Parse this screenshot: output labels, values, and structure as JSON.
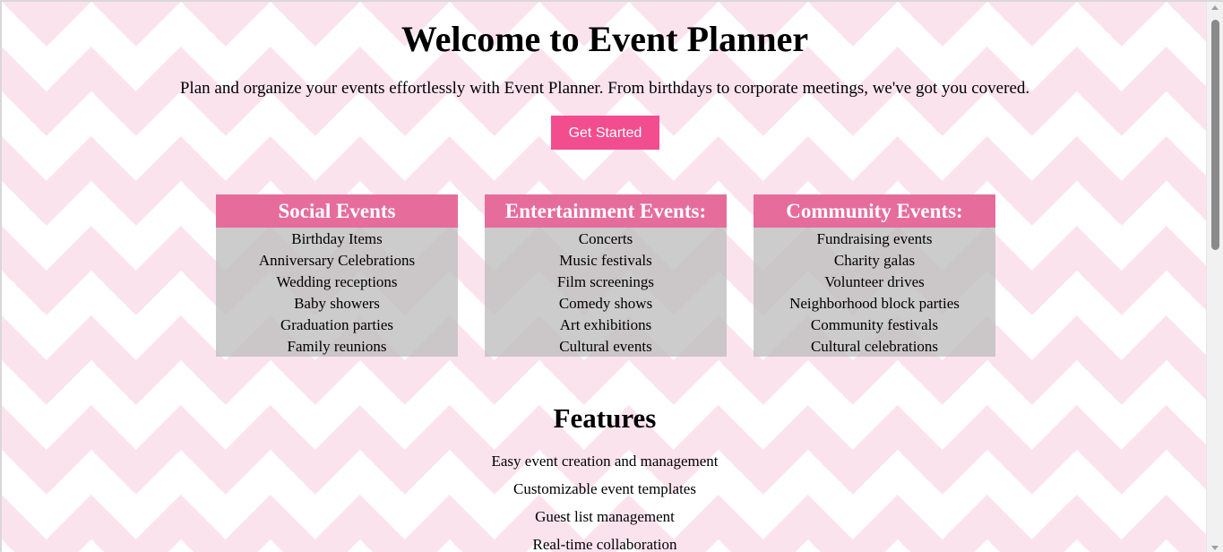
{
  "hero": {
    "title": "Welcome to Event Planner",
    "intro": "Plan and organize your events effortlessly with Event Planner. From birthdays to corporate meetings, we've got you covered.",
    "cta_label": "Get Started"
  },
  "categories": [
    {
      "heading": "Social Events",
      "items": [
        "Birthday Items",
        "Anniversary Celebrations",
        "Wedding receptions",
        "Baby showers",
        "Graduation parties",
        "Family reunions"
      ]
    },
    {
      "heading": "Entertainment Events:",
      "items": [
        "Concerts",
        "Music festivals",
        "Film screenings",
        "Comedy shows",
        "Art exhibitions",
        "Cultural events"
      ]
    },
    {
      "heading": "Community Events:",
      "items": [
        "Fundraising events",
        "Charity galas",
        "Volunteer drives",
        "Neighborhood block parties",
        "Community festivals",
        "Cultural celebrations"
      ]
    }
  ],
  "features": {
    "title": "Features",
    "items": [
      "Easy event creation and management",
      "Customizable event templates",
      "Guest list management",
      "Real-time collaboration"
    ]
  },
  "colors": {
    "accent_button": "#f24d8e",
    "card_header": "#e66c9c",
    "chevron_pink": "#fbe3ee",
    "card_body": "#c8c8c8"
  }
}
